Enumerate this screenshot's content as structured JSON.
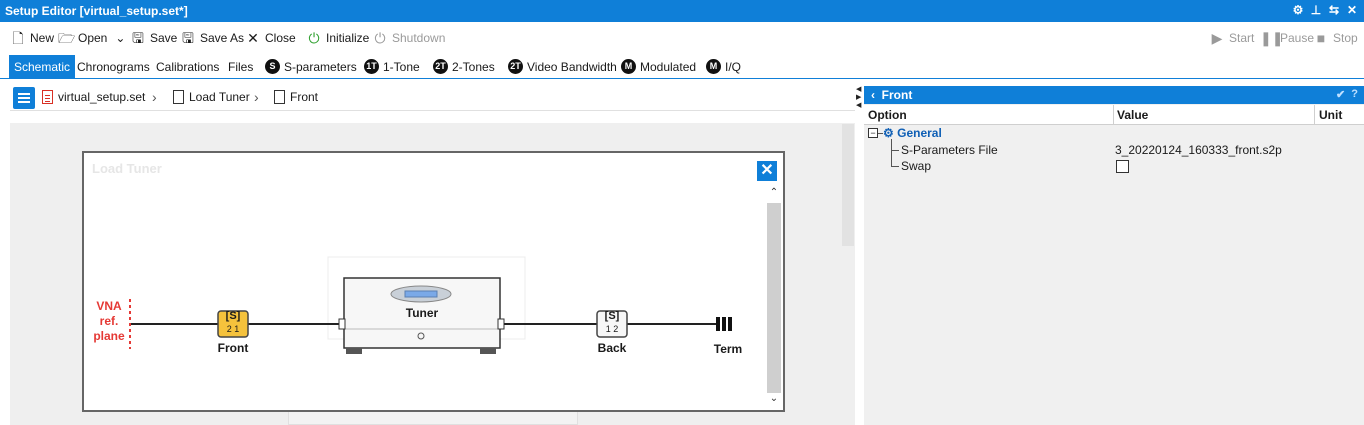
{
  "window": {
    "title": "Setup Editor [virtual_setup.set*]",
    "icons": [
      "gear-icon",
      "pin-icon",
      "swap-icon",
      "close-icon"
    ]
  },
  "toolbar": {
    "new": "New",
    "open": "Open",
    "save": "Save",
    "save_as": "Save As",
    "close": "Close",
    "initialize": "Initialize",
    "shutdown": "Shutdown",
    "start": "Start",
    "pause": "Pause",
    "stop": "Stop"
  },
  "tabs": [
    {
      "label": "Schematic",
      "active": true
    },
    {
      "label": "Chronograms"
    },
    {
      "label": "Calibrations"
    },
    {
      "label": "Files"
    },
    {
      "label": "S-parameters",
      "badge": "S"
    },
    {
      "label": "1-Tone",
      "badge": "1T"
    },
    {
      "label": "2-Tones",
      "badge": "2T"
    },
    {
      "label": "Video Bandwidth",
      "badge": "2T"
    },
    {
      "label": "Modulated",
      "badge": "M"
    },
    {
      "label": "I/Q",
      "badge": "M"
    }
  ],
  "breadcrumb": [
    "virtual_setup.set",
    "Load Tuner",
    "Front"
  ],
  "modal": {
    "title": "Load Tuner",
    "close_label": "✕"
  },
  "schematic": {
    "ref_plane": [
      "VNA",
      "ref.",
      "plane"
    ],
    "front": {
      "label": "Front",
      "block": "[S]",
      "ports": "2  1"
    },
    "tuner": {
      "label": "Tuner"
    },
    "back": {
      "label": "Back",
      "block": "[S]",
      "ports": "1  2"
    },
    "term": {
      "label": "Term"
    },
    "colors": {
      "front_block": "#f5c23c",
      "ref_plane": "#e53935",
      "accent": "#0f7fd8"
    }
  },
  "properties": {
    "header": "Front",
    "columns": [
      "Option",
      "Value",
      "Unit"
    ],
    "group": "General",
    "rows": [
      {
        "option": "S-Parameters File",
        "value": "3_20220124_160333_front.s2p"
      },
      {
        "option": "Swap",
        "value": ""
      }
    ]
  }
}
